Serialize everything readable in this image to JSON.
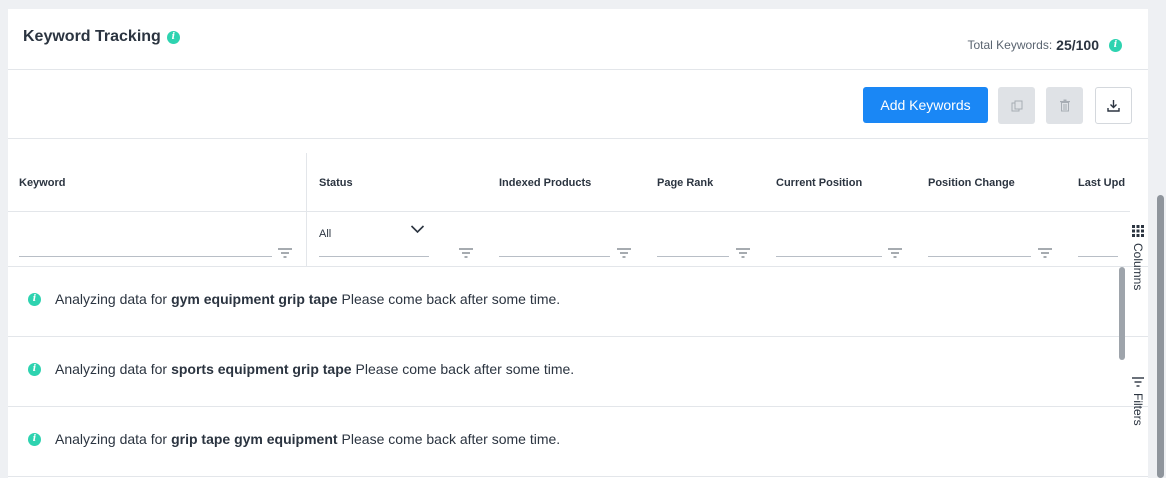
{
  "header": {
    "title": "Keyword Tracking",
    "total_label": "Total Keywords:",
    "total_value": "25/100"
  },
  "toolbar": {
    "add_label": "Add Keywords"
  },
  "columns": [
    "Keyword",
    "Status",
    "Indexed Products",
    "Page Rank",
    "Current Position",
    "Position Change",
    "Last Upd"
  ],
  "status_filter": {
    "selected": "All"
  },
  "rows": [
    {
      "prefix": "Analyzing data for",
      "keyword": "gym equipment grip tape",
      "suffix": "Please come back after some time."
    },
    {
      "prefix": "Analyzing data for",
      "keyword": "sports equipment grip tape",
      "suffix": "Please come back after some time."
    },
    {
      "prefix": "Analyzing data for",
      "keyword": "grip tape gym equipment",
      "suffix": "Please come back after some time."
    }
  ],
  "side_tabs": {
    "columns": "Columns",
    "filters": "Filters"
  },
  "colors": {
    "accent": "#1a87f5",
    "info": "#2ed3b0"
  },
  "icons": [
    "info-icon",
    "copy-icon",
    "trash-icon",
    "download-icon",
    "filter-icon",
    "chevron-down-icon",
    "grid-icon",
    "filter-lines-icon"
  ]
}
